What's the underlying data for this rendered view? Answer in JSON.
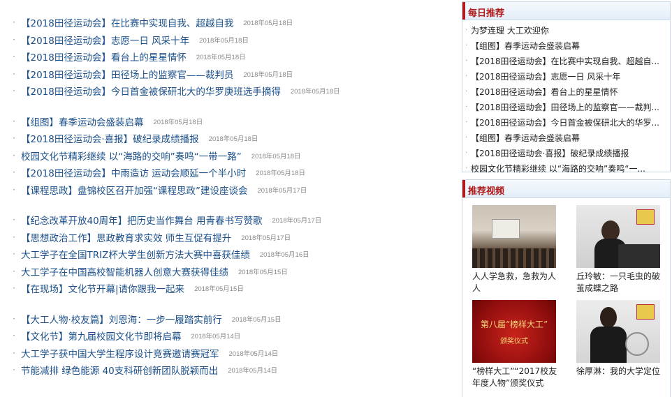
{
  "news_groups": [
    [
      {
        "title": "【2018田径运动会】在比赛中实现自我、超越自我",
        "date": "2018年05月18日"
      },
      {
        "title": "【2018田径运动会】志愿一日 风采十年",
        "date": "2018年05月18日"
      },
      {
        "title": "【2018田径运动会】看台上的星星情怀",
        "date": "2018年05月18日"
      },
      {
        "title": "【2018田径运动会】田径场上的监察官——裁判员",
        "date": "2018年05月18日"
      },
      {
        "title": "【2018田径运动会】今日首金被保研北大的华罗庚班选手摘得",
        "date": "2018年05月18日"
      }
    ],
    [
      {
        "title": "【组图】春季运动会盛装启幕",
        "date": "2018年05月18日"
      },
      {
        "title": "【2018田径运动会·喜报】破纪录成绩播报",
        "date": "2018年05月18日"
      },
      {
        "title": "校园文化节精彩继续 以“海路的交响”奏鸣“一带一路”",
        "date": "2018年05月18日"
      },
      {
        "title": "【2018田径运动会】中雨造访 运动会顺延一个半小时",
        "date": "2018年05月18日"
      },
      {
        "title": "【课程思政】盘锦校区召开加强“课程思政”建设座谈会",
        "date": "2018年05月17日"
      }
    ],
    [
      {
        "title": "【纪念改革开放40周年】把历史当作舞台 用青春书写赞歌",
        "date": "2018年05月17日"
      },
      {
        "title": "【思想政治工作】思政教育求实效 师生互促有提升",
        "date": "2018年05月17日"
      },
      {
        "title": "大工学子在全国TRIZ杯大学生创新方法大赛中喜获佳绩",
        "date": "2018年05月16日"
      },
      {
        "title": "大工学子在中国高校智能机器人创意大赛获得佳绩",
        "date": "2018年05月15日"
      },
      {
        "title": "【在现场】文化节开幕|请你跟我一起来",
        "date": "2018年05月15日"
      }
    ],
    [
      {
        "title": "【大工人物·校友篇】刘恩海：一步一履踏实前行",
        "date": "2018年05月15日"
      },
      {
        "title": "【文化节】第九届校园文化节即将启幕",
        "date": "2018年05月14日"
      },
      {
        "title": "大工学子获中国大学生程序设计竞赛邀请赛冠军",
        "date": "2018年05月14日"
      },
      {
        "title": "节能减排 绿色能源 40支科研创新团队脱颖而出",
        "date": "2018年05月14日"
      }
    ]
  ],
  "daily": {
    "heading": "每日推荐",
    "items": [
      "为梦连理 大工欢迎你",
      "【组图】春季运动会盛装启幕",
      "【2018田径运动会】在比赛中实现自我、超越自...",
      "【2018田径运动会】志愿一日 风采十年",
      "【2018田径运动会】看台上的星星情怀",
      "【2018田径运动会】田径场上的监察官——裁判...",
      "【2018田径运动会】今日首金被保研北大的华罗...",
      "【组图】春季运动会盛装启幕",
      "【2018田径运动会·喜报】破纪录成绩播报",
      "校园文化节精彩继续 以“海路的交响”奏鸣“一..."
    ]
  },
  "videos": {
    "heading": "推荐视频",
    "items": [
      {
        "caption": "人人学急救，急救为人人"
      },
      {
        "caption": "丘玲敏：一只毛虫的破茧成蝶之路"
      },
      {
        "caption": "“榜样大工”“2017校友年度人物”颁奖仪式",
        "thumb_text": "第八届“榜样大工”",
        "thumb_sub": "颁奖仪式"
      },
      {
        "caption": "徐厚淋：我的大学定位"
      }
    ]
  },
  "colors": {
    "link": "#1a4f8a",
    "accent": "#b01a1a",
    "date": "#888888"
  }
}
